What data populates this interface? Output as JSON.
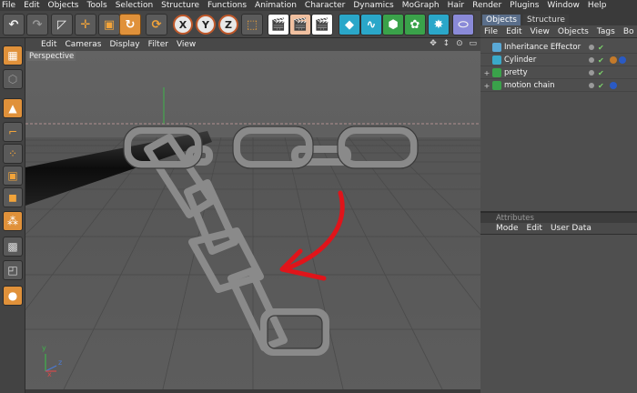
{
  "menubar": {
    "items": [
      "File",
      "Edit",
      "Objects",
      "Tools",
      "Selection",
      "Structure",
      "Functions",
      "Animation",
      "Character",
      "Dynamics",
      "MoGraph",
      "Hair",
      "Render",
      "Plugins",
      "Window",
      "Help"
    ]
  },
  "toolbar": {
    "x_label": "X",
    "y_label": "Y",
    "z_label": "Z"
  },
  "object_manager": {
    "tabs": [
      "Objects",
      "Structure"
    ],
    "menu": [
      "File",
      "Edit",
      "View",
      "Objects",
      "Tags",
      "Bo"
    ],
    "objects": [
      {
        "name": "Inheritance Effector",
        "expand": ""
      },
      {
        "name": "Cylinder",
        "expand": ""
      },
      {
        "name": "pretty",
        "expand": "+"
      },
      {
        "name": "motion chain",
        "expand": "+"
      }
    ]
  },
  "attributes": {
    "title": "Attributes",
    "menu": [
      "Mode",
      "Edit",
      "User Data"
    ]
  },
  "viewport": {
    "menu": [
      "Edit",
      "Cameras",
      "Display",
      "Filter",
      "View"
    ],
    "controls": "✥ ↕ ⊙ ▭",
    "label": "Perspective",
    "axis_x": "x",
    "axis_y": "y",
    "axis_z": "z"
  },
  "colors": {
    "accent_orange": "#e0913a",
    "annotation_red": "#e0141a",
    "viewport_bg": "#5c5c5c"
  },
  "icons": [
    "undo-icon",
    "redo-icon",
    "live-select-icon",
    "move-icon",
    "scale-icon",
    "rotate-icon",
    "recent-icon",
    "x-axis-icon",
    "y-axis-icon",
    "z-axis-icon",
    "world-coords-icon",
    "render-view-icon",
    "render-picture-viewer-icon",
    "render-settings-icon",
    "cube-icon",
    "spline-icon",
    "nurbs-icon",
    "array-icon",
    "deformer-icon",
    "scene-icon",
    "model-mode-icon",
    "object-mode-icon",
    "points-mode-icon",
    "edges-mode-icon",
    "polygons-mode-icon"
  ]
}
